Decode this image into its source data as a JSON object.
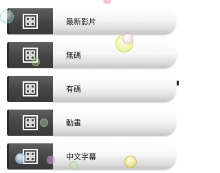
{
  "menu": {
    "items": [
      {
        "label": "最新影片",
        "icon": "grid-icon"
      },
      {
        "label": "無碼",
        "icon": "grid-icon"
      },
      {
        "label": "有碼",
        "icon": "grid-icon"
      },
      {
        "label": "動畫",
        "icon": "grid-icon"
      },
      {
        "label": "中文字幕",
        "icon": "grid-icon"
      }
    ]
  },
  "colors": {
    "icon_bg": "#444444",
    "label_bg": "#f6f6f6",
    "text": "#111111"
  }
}
